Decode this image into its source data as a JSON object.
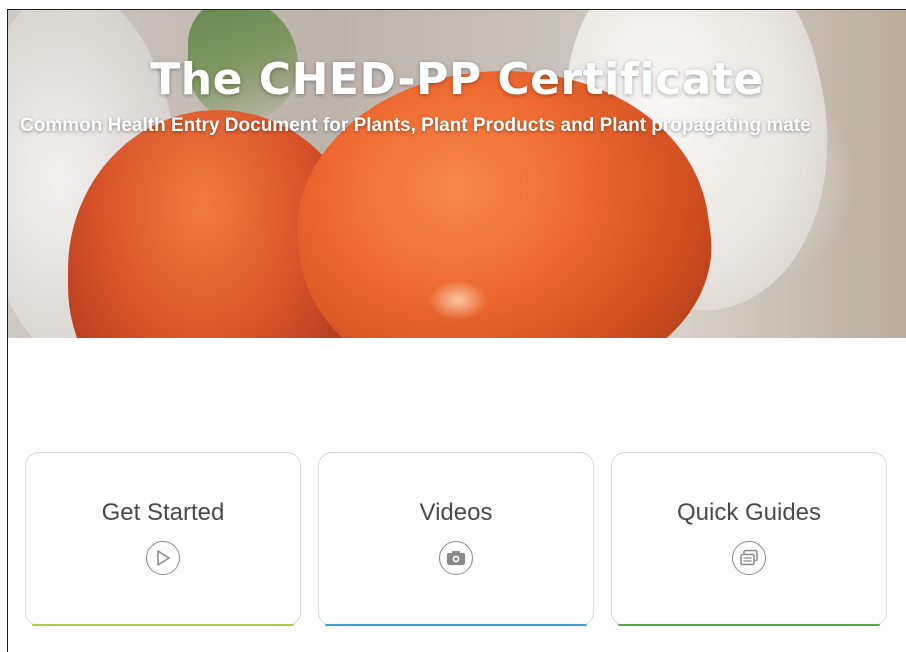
{
  "hero": {
    "title": "The CHED-PP Certificate",
    "subtitle": "Common Health Entry Document for Plants, Plant Products and Plant propagating mate"
  },
  "cards": [
    {
      "label": "Get Started",
      "icon": "play-circle-icon",
      "accent": "#a8cf45"
    },
    {
      "label": "Videos",
      "icon": "camera-icon",
      "accent": "#36a3d9"
    },
    {
      "label": "Quick Guides",
      "icon": "documents-icon",
      "accent": "#55a84a"
    }
  ]
}
